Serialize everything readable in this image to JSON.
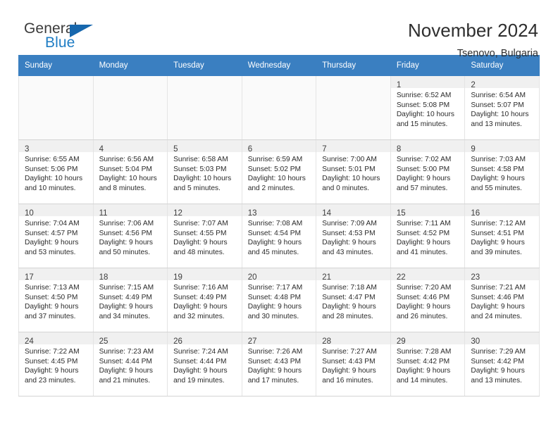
{
  "brand": {
    "name_part1": "General",
    "name_part2": "Blue",
    "accent_color": "#1f7dc4",
    "triangle_color": "#1767ad"
  },
  "header": {
    "title": "November 2024",
    "subtitle": "Tsenovo, Bulgaria"
  },
  "calendar": {
    "header_bg": "#3a7fc1",
    "weekday_headers": [
      "Sunday",
      "Monday",
      "Tuesday",
      "Wednesday",
      "Thursday",
      "Friday",
      "Saturday"
    ],
    "weeks": [
      [
        {
          "day": "",
          "sunrise": "",
          "sunset": "",
          "daylight_line1": "",
          "daylight_line2": "",
          "empty": true
        },
        {
          "day": "",
          "sunrise": "",
          "sunset": "",
          "daylight_line1": "",
          "daylight_line2": "",
          "empty": true
        },
        {
          "day": "",
          "sunrise": "",
          "sunset": "",
          "daylight_line1": "",
          "daylight_line2": "",
          "empty": true
        },
        {
          "day": "",
          "sunrise": "",
          "sunset": "",
          "daylight_line1": "",
          "daylight_line2": "",
          "empty": true
        },
        {
          "day": "",
          "sunrise": "",
          "sunset": "",
          "daylight_line1": "",
          "daylight_line2": "",
          "empty": true
        },
        {
          "day": "1",
          "sunrise": "Sunrise: 6:52 AM",
          "sunset": "Sunset: 5:08 PM",
          "daylight_line1": "Daylight: 10 hours",
          "daylight_line2": "and 15 minutes.",
          "empty": false
        },
        {
          "day": "2",
          "sunrise": "Sunrise: 6:54 AM",
          "sunset": "Sunset: 5:07 PM",
          "daylight_line1": "Daylight: 10 hours",
          "daylight_line2": "and 13 minutes.",
          "empty": false
        }
      ],
      [
        {
          "day": "3",
          "sunrise": "Sunrise: 6:55 AM",
          "sunset": "Sunset: 5:06 PM",
          "daylight_line1": "Daylight: 10 hours",
          "daylight_line2": "and 10 minutes.",
          "empty": false
        },
        {
          "day": "4",
          "sunrise": "Sunrise: 6:56 AM",
          "sunset": "Sunset: 5:04 PM",
          "daylight_line1": "Daylight: 10 hours",
          "daylight_line2": "and 8 minutes.",
          "empty": false
        },
        {
          "day": "5",
          "sunrise": "Sunrise: 6:58 AM",
          "sunset": "Sunset: 5:03 PM",
          "daylight_line1": "Daylight: 10 hours",
          "daylight_line2": "and 5 minutes.",
          "empty": false
        },
        {
          "day": "6",
          "sunrise": "Sunrise: 6:59 AM",
          "sunset": "Sunset: 5:02 PM",
          "daylight_line1": "Daylight: 10 hours",
          "daylight_line2": "and 2 minutes.",
          "empty": false
        },
        {
          "day": "7",
          "sunrise": "Sunrise: 7:00 AM",
          "sunset": "Sunset: 5:01 PM",
          "daylight_line1": "Daylight: 10 hours",
          "daylight_line2": "and 0 minutes.",
          "empty": false
        },
        {
          "day": "8",
          "sunrise": "Sunrise: 7:02 AM",
          "sunset": "Sunset: 5:00 PM",
          "daylight_line1": "Daylight: 9 hours",
          "daylight_line2": "and 57 minutes.",
          "empty": false
        },
        {
          "day": "9",
          "sunrise": "Sunrise: 7:03 AM",
          "sunset": "Sunset: 4:58 PM",
          "daylight_line1": "Daylight: 9 hours",
          "daylight_line2": "and 55 minutes.",
          "empty": false
        }
      ],
      [
        {
          "day": "10",
          "sunrise": "Sunrise: 7:04 AM",
          "sunset": "Sunset: 4:57 PM",
          "daylight_line1": "Daylight: 9 hours",
          "daylight_line2": "and 53 minutes.",
          "empty": false
        },
        {
          "day": "11",
          "sunrise": "Sunrise: 7:06 AM",
          "sunset": "Sunset: 4:56 PM",
          "daylight_line1": "Daylight: 9 hours",
          "daylight_line2": "and 50 minutes.",
          "empty": false
        },
        {
          "day": "12",
          "sunrise": "Sunrise: 7:07 AM",
          "sunset": "Sunset: 4:55 PM",
          "daylight_line1": "Daylight: 9 hours",
          "daylight_line2": "and 48 minutes.",
          "empty": false
        },
        {
          "day": "13",
          "sunrise": "Sunrise: 7:08 AM",
          "sunset": "Sunset: 4:54 PM",
          "daylight_line1": "Daylight: 9 hours",
          "daylight_line2": "and 45 minutes.",
          "empty": false
        },
        {
          "day": "14",
          "sunrise": "Sunrise: 7:09 AM",
          "sunset": "Sunset: 4:53 PM",
          "daylight_line1": "Daylight: 9 hours",
          "daylight_line2": "and 43 minutes.",
          "empty": false
        },
        {
          "day": "15",
          "sunrise": "Sunrise: 7:11 AM",
          "sunset": "Sunset: 4:52 PM",
          "daylight_line1": "Daylight: 9 hours",
          "daylight_line2": "and 41 minutes.",
          "empty": false
        },
        {
          "day": "16",
          "sunrise": "Sunrise: 7:12 AM",
          "sunset": "Sunset: 4:51 PM",
          "daylight_line1": "Daylight: 9 hours",
          "daylight_line2": "and 39 minutes.",
          "empty": false
        }
      ],
      [
        {
          "day": "17",
          "sunrise": "Sunrise: 7:13 AM",
          "sunset": "Sunset: 4:50 PM",
          "daylight_line1": "Daylight: 9 hours",
          "daylight_line2": "and 37 minutes.",
          "empty": false
        },
        {
          "day": "18",
          "sunrise": "Sunrise: 7:15 AM",
          "sunset": "Sunset: 4:49 PM",
          "daylight_line1": "Daylight: 9 hours",
          "daylight_line2": "and 34 minutes.",
          "empty": false
        },
        {
          "day": "19",
          "sunrise": "Sunrise: 7:16 AM",
          "sunset": "Sunset: 4:49 PM",
          "daylight_line1": "Daylight: 9 hours",
          "daylight_line2": "and 32 minutes.",
          "empty": false
        },
        {
          "day": "20",
          "sunrise": "Sunrise: 7:17 AM",
          "sunset": "Sunset: 4:48 PM",
          "daylight_line1": "Daylight: 9 hours",
          "daylight_line2": "and 30 minutes.",
          "empty": false
        },
        {
          "day": "21",
          "sunrise": "Sunrise: 7:18 AM",
          "sunset": "Sunset: 4:47 PM",
          "daylight_line1": "Daylight: 9 hours",
          "daylight_line2": "and 28 minutes.",
          "empty": false
        },
        {
          "day": "22",
          "sunrise": "Sunrise: 7:20 AM",
          "sunset": "Sunset: 4:46 PM",
          "daylight_line1": "Daylight: 9 hours",
          "daylight_line2": "and 26 minutes.",
          "empty": false
        },
        {
          "day": "23",
          "sunrise": "Sunrise: 7:21 AM",
          "sunset": "Sunset: 4:46 PM",
          "daylight_line1": "Daylight: 9 hours",
          "daylight_line2": "and 24 minutes.",
          "empty": false
        }
      ],
      [
        {
          "day": "24",
          "sunrise": "Sunrise: 7:22 AM",
          "sunset": "Sunset: 4:45 PM",
          "daylight_line1": "Daylight: 9 hours",
          "daylight_line2": "and 23 minutes.",
          "empty": false
        },
        {
          "day": "25",
          "sunrise": "Sunrise: 7:23 AM",
          "sunset": "Sunset: 4:44 PM",
          "daylight_line1": "Daylight: 9 hours",
          "daylight_line2": "and 21 minutes.",
          "empty": false
        },
        {
          "day": "26",
          "sunrise": "Sunrise: 7:24 AM",
          "sunset": "Sunset: 4:44 PM",
          "daylight_line1": "Daylight: 9 hours",
          "daylight_line2": "and 19 minutes.",
          "empty": false
        },
        {
          "day": "27",
          "sunrise": "Sunrise: 7:26 AM",
          "sunset": "Sunset: 4:43 PM",
          "daylight_line1": "Daylight: 9 hours",
          "daylight_line2": "and 17 minutes.",
          "empty": false
        },
        {
          "day": "28",
          "sunrise": "Sunrise: 7:27 AM",
          "sunset": "Sunset: 4:43 PM",
          "daylight_line1": "Daylight: 9 hours",
          "daylight_line2": "and 16 minutes.",
          "empty": false
        },
        {
          "day": "29",
          "sunrise": "Sunrise: 7:28 AM",
          "sunset": "Sunset: 4:42 PM",
          "daylight_line1": "Daylight: 9 hours",
          "daylight_line2": "and 14 minutes.",
          "empty": false
        },
        {
          "day": "30",
          "sunrise": "Sunrise: 7:29 AM",
          "sunset": "Sunset: 4:42 PM",
          "daylight_line1": "Daylight: 9 hours",
          "daylight_line2": "and 13 minutes.",
          "empty": false
        }
      ]
    ]
  }
}
